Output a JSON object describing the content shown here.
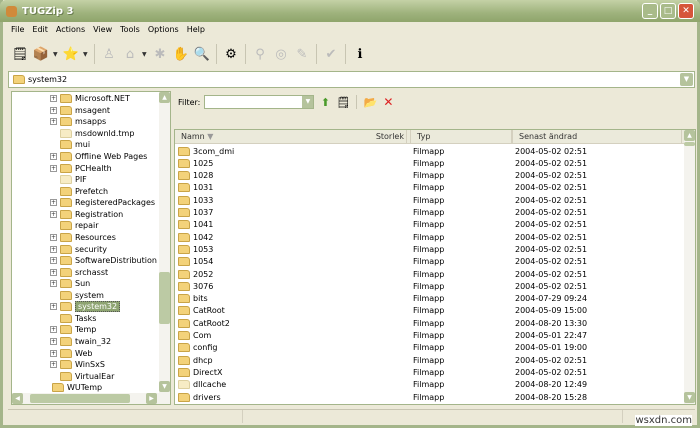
{
  "window": {
    "title": "TUGZip 3"
  },
  "menu": [
    "File",
    "Edit",
    "Actions",
    "View",
    "Tools",
    "Options",
    "Help"
  ],
  "toolbar": [
    {
      "name": "new-archive",
      "icon": "🗒",
      "enabled": true
    },
    {
      "name": "open-archive",
      "icon": "📦",
      "enabled": true,
      "dropdown": true
    },
    {
      "name": "favorites",
      "icon": "⭐",
      "enabled": true,
      "dropdown": true
    },
    {
      "name": "extract",
      "icon": "♙",
      "enabled": false
    },
    {
      "name": "add",
      "icon": "⌂",
      "enabled": false,
      "dropdown": true
    },
    {
      "name": "delete",
      "icon": "✱",
      "enabled": false
    },
    {
      "name": "view",
      "icon": "✋",
      "enabled": false
    },
    {
      "name": "search",
      "icon": "🔍",
      "enabled": false
    },
    {
      "name": "settings",
      "icon": "⚙",
      "enabled": true
    },
    {
      "name": "encrypt",
      "icon": "⚲",
      "enabled": false
    },
    {
      "name": "repair",
      "icon": "◎",
      "enabled": false
    },
    {
      "name": "comment",
      "icon": "✎",
      "enabled": false
    },
    {
      "name": "test",
      "icon": "✔",
      "enabled": false
    },
    {
      "name": "about",
      "icon": "ℹ",
      "enabled": true
    }
  ],
  "address": {
    "value": "system32"
  },
  "tree": {
    "items": [
      {
        "label": "Microsoft.NET",
        "expand": true,
        "level": 2
      },
      {
        "label": "msagent",
        "expand": true,
        "level": 2
      },
      {
        "label": "msapps",
        "expand": true,
        "level": 2
      },
      {
        "label": "msdownld.tmp",
        "expand": false,
        "level": 2,
        "pale": true
      },
      {
        "label": "mui",
        "expand": false,
        "level": 2
      },
      {
        "label": "Offline Web Pages",
        "expand": true,
        "level": 2
      },
      {
        "label": "PCHealth",
        "expand": true,
        "level": 2
      },
      {
        "label": "PIF",
        "expand": false,
        "level": 2,
        "pale": true
      },
      {
        "label": "Prefetch",
        "expand": false,
        "level": 2
      },
      {
        "label": "RegisteredPackages",
        "expand": true,
        "level": 2
      },
      {
        "label": "Registration",
        "expand": true,
        "level": 2
      },
      {
        "label": "repair",
        "expand": false,
        "level": 2
      },
      {
        "label": "Resources",
        "expand": true,
        "level": 2
      },
      {
        "label": "security",
        "expand": true,
        "level": 2
      },
      {
        "label": "SoftwareDistribution",
        "expand": true,
        "level": 2
      },
      {
        "label": "srchasst",
        "expand": true,
        "level": 2
      },
      {
        "label": "Sun",
        "expand": true,
        "level": 2
      },
      {
        "label": "system",
        "expand": false,
        "level": 2
      },
      {
        "label": "system32",
        "expand": true,
        "level": 2,
        "selected": true
      },
      {
        "label": "Tasks",
        "expand": false,
        "level": 2
      },
      {
        "label": "Temp",
        "expand": true,
        "level": 2
      },
      {
        "label": "twain_32",
        "expand": true,
        "level": 2
      },
      {
        "label": "Web",
        "expand": true,
        "level": 2
      },
      {
        "label": "WinSxS",
        "expand": true,
        "level": 2
      },
      {
        "label": "VirtualEar",
        "expand": false,
        "level": 2
      },
      {
        "label": "WUTemp",
        "expand": false,
        "level": 1
      }
    ]
  },
  "filter": {
    "label": "Filter:",
    "value": ""
  },
  "list": {
    "columns": [
      "Namn",
      "Storlek",
      "Typ",
      "Senast ändrad"
    ],
    "rows": [
      {
        "name": "3com_dmi",
        "size": "",
        "type": "Filmapp",
        "modified": "2004-05-02 02:51"
      },
      {
        "name": "1025",
        "size": "",
        "type": "Filmapp",
        "modified": "2004-05-02 02:51"
      },
      {
        "name": "1028",
        "size": "",
        "type": "Filmapp",
        "modified": "2004-05-02 02:51"
      },
      {
        "name": "1031",
        "size": "",
        "type": "Filmapp",
        "modified": "2004-05-02 02:51"
      },
      {
        "name": "1033",
        "size": "",
        "type": "Filmapp",
        "modified": "2004-05-02 02:51"
      },
      {
        "name": "1037",
        "size": "",
        "type": "Filmapp",
        "modified": "2004-05-02 02:51"
      },
      {
        "name": "1041",
        "size": "",
        "type": "Filmapp",
        "modified": "2004-05-02 02:51"
      },
      {
        "name": "1042",
        "size": "",
        "type": "Filmapp",
        "modified": "2004-05-02 02:51"
      },
      {
        "name": "1053",
        "size": "",
        "type": "Filmapp",
        "modified": "2004-05-02 02:51"
      },
      {
        "name": "1054",
        "size": "",
        "type": "Filmapp",
        "modified": "2004-05-02 02:51"
      },
      {
        "name": "2052",
        "size": "",
        "type": "Filmapp",
        "modified": "2004-05-02 02:51"
      },
      {
        "name": "3076",
        "size": "",
        "type": "Filmapp",
        "modified": "2004-05-02 02:51"
      },
      {
        "name": "bits",
        "size": "",
        "type": "Filmapp",
        "modified": "2004-07-29 09:24"
      },
      {
        "name": "CatRoot",
        "size": "",
        "type": "Filmapp",
        "modified": "2004-05-09 15:00"
      },
      {
        "name": "CatRoot2",
        "size": "",
        "type": "Filmapp",
        "modified": "2004-08-20 13:30"
      },
      {
        "name": "Com",
        "size": "",
        "type": "Filmapp",
        "modified": "2004-05-01 22:47"
      },
      {
        "name": "config",
        "size": "",
        "type": "Filmapp",
        "modified": "2004-05-01 19:00"
      },
      {
        "name": "dhcp",
        "size": "",
        "type": "Filmapp",
        "modified": "2004-05-02 02:51"
      },
      {
        "name": "DirectX",
        "size": "",
        "type": "Filmapp",
        "modified": "2004-05-02 02:51"
      },
      {
        "name": "dllcache",
        "size": "",
        "type": "Filmapp",
        "modified": "2004-08-20 12:49",
        "pale": true
      },
      {
        "name": "drivers",
        "size": "",
        "type": "Filmapp",
        "modified": "2004-08-20 15:28"
      }
    ]
  },
  "watermark": "wsxdn.com"
}
